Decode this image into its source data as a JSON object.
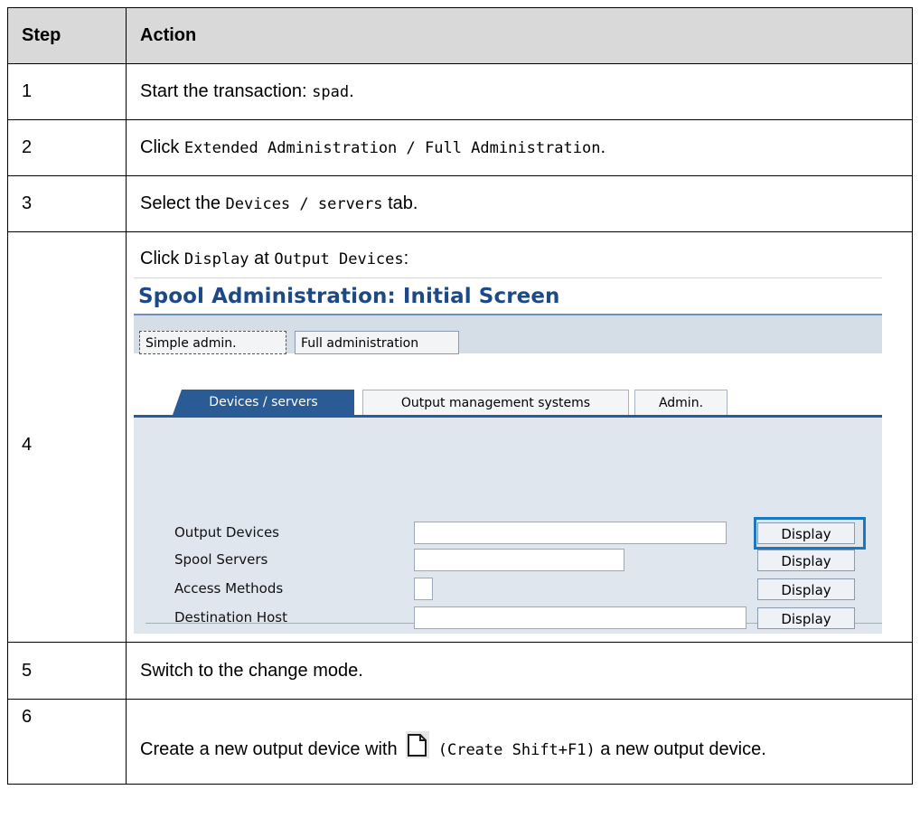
{
  "table": {
    "header": {
      "step": "Step",
      "action": "Action"
    },
    "rows": [
      {
        "step": "1",
        "pre": "Start the transaction: ",
        "code": "spad",
        "post": "."
      },
      {
        "step": "2",
        "pre": "Click ",
        "code": "Extended Administration / Full Administration",
        "post": "."
      },
      {
        "step": "3",
        "pre": "Select the ",
        "code": "Devices / servers",
        "post": " tab."
      },
      {
        "step": "4",
        "pre": "Click ",
        "code": "Display",
        "mid": " at ",
        "code2": "Output Devices",
        "post": ":"
      },
      {
        "step": "5",
        "text": "Switch to the change mode."
      },
      {
        "step": "6",
        "pre": "Create a new output device with ",
        "code": "(Create  Shift+F1)",
        "post": " a new output device.",
        "icon": "create-document-icon"
      }
    ]
  },
  "sap": {
    "title": "Spool Administration: Initial Screen",
    "buttons": {
      "simple": "Simple admin.",
      "full": "Full administration"
    },
    "tabs": [
      "Devices / servers",
      "Output management systems",
      "Admin."
    ],
    "fields": [
      {
        "label": "Output Devices",
        "button": "Display"
      },
      {
        "label": "Spool Servers",
        "button": "Display"
      },
      {
        "label": "Access Methods",
        "button": "Display"
      },
      {
        "label": "Destination Host",
        "button": "Display"
      }
    ],
    "colors": {
      "title": "#1d4a87",
      "tab_active": "#2a5b94",
      "panel": "#dfe6ee",
      "highlight": "#1a78c2"
    }
  }
}
